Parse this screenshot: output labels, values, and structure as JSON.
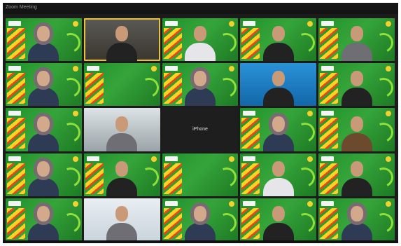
{
  "window": {
    "title": "Zoom Meeting"
  },
  "tiles": [
    {
      "id": "r1c1",
      "bg": "green",
      "person": "hijab",
      "speaking": false
    },
    {
      "id": "r1c2",
      "bg": "room",
      "person": "black",
      "speaking": true
    },
    {
      "id": "r1c3",
      "bg": "green",
      "person": "white",
      "speaking": false
    },
    {
      "id": "r1c4",
      "bg": "green",
      "person": "black",
      "speaking": false
    },
    {
      "id": "r1c5",
      "bg": "green",
      "person": "grey",
      "speaking": false
    },
    {
      "id": "r2c1",
      "bg": "green",
      "person": "hijab",
      "speaking": false
    },
    {
      "id": "r2c2",
      "bg": "green",
      "person": "none",
      "speaking": false
    },
    {
      "id": "r2c3",
      "bg": "green",
      "person": "hijab",
      "speaking": false
    },
    {
      "id": "r2c4",
      "bg": "blue",
      "person": "black",
      "speaking": false
    },
    {
      "id": "r2c5",
      "bg": "green",
      "person": "black",
      "speaking": false
    },
    {
      "id": "r3c1",
      "bg": "green",
      "person": "hijab",
      "speaking": false
    },
    {
      "id": "r3c2",
      "bg": "light",
      "person": "grey",
      "speaking": false
    },
    {
      "id": "r3c3",
      "bg": "dark",
      "person": "none",
      "label": "iPhone",
      "speaking": false
    },
    {
      "id": "r3c4",
      "bg": "green",
      "person": "hijab",
      "speaking": false
    },
    {
      "id": "r3c5",
      "bg": "green",
      "person": "brown",
      "speaking": false
    },
    {
      "id": "r4c1",
      "bg": "green",
      "person": "hijab",
      "speaking": false
    },
    {
      "id": "r4c2",
      "bg": "green",
      "person": "black",
      "speaking": false
    },
    {
      "id": "r4c3",
      "bg": "green",
      "person": "none",
      "speaking": false
    },
    {
      "id": "r4c4",
      "bg": "green",
      "person": "white",
      "speaking": false
    },
    {
      "id": "r4c5",
      "bg": "green",
      "person": "black",
      "speaking": false
    },
    {
      "id": "r5c1",
      "bg": "green",
      "person": "hijab",
      "speaking": false
    },
    {
      "id": "r5c2",
      "bg": "slide",
      "person": "grey",
      "speaking": false
    },
    {
      "id": "r5c3",
      "bg": "green",
      "person": "hijab",
      "speaking": false
    },
    {
      "id": "r5c4",
      "bg": "green",
      "person": "black",
      "speaking": false
    },
    {
      "id": "r5c5",
      "bg": "green",
      "person": "hijab",
      "speaking": false
    }
  ]
}
